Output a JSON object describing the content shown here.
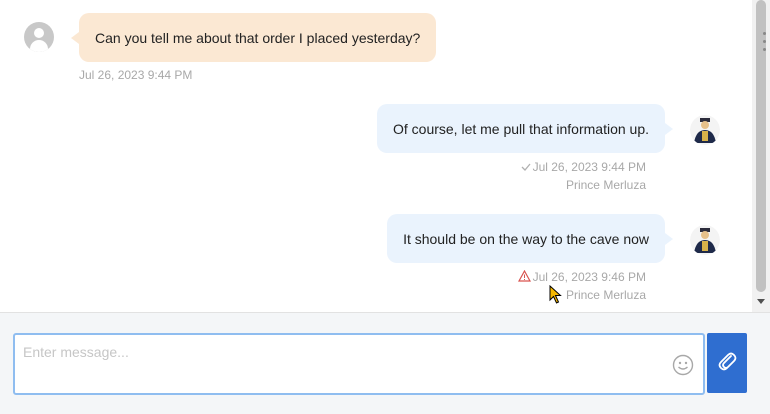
{
  "messages": [
    {
      "direction": "in",
      "text": "Can you tell me about that order I placed yesterday?",
      "timestamp": "Jul 26, 2023 9:44 PM",
      "sender": ""
    },
    {
      "direction": "out",
      "text": "Of course, let me pull that information up.",
      "timestamp": "Jul 26, 2023 9:44 PM",
      "status": "sent-check-icon",
      "sender": "Prince Merluza"
    },
    {
      "direction": "out",
      "text": "It should be on the way to the cave now",
      "timestamp": "Jul 26, 2023 9:46 PM",
      "status": "warning-icon",
      "sender": "Prince Merluza"
    }
  ],
  "composer": {
    "placeholder": "Enter message...",
    "value": "",
    "emoji_icon": "smiley-icon",
    "attach_icon": "paperclip-icon"
  },
  "colors": {
    "incoming_bubble": "#fbe8d3",
    "outgoing_bubble": "#eaf3fd",
    "accent": "#2f6ed0",
    "warning": "#d9534f"
  }
}
